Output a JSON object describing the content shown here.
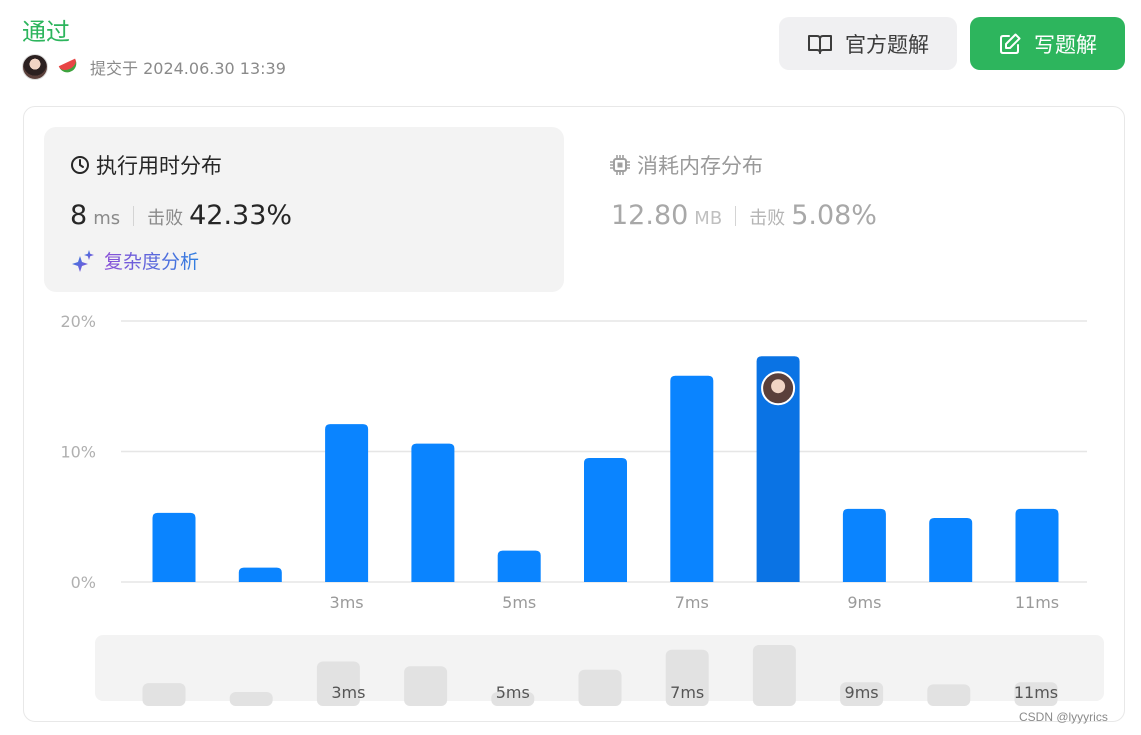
{
  "header": {
    "status": "通过",
    "submitted": "提交于 2024.06.30 13:39"
  },
  "buttons": {
    "official_solution": "官方题解",
    "write_solution": "写题解"
  },
  "runtime": {
    "title": "执行用时分布",
    "value": "8",
    "unit": "ms",
    "beat_label": "击败",
    "beat_value": "42.33%",
    "complexity_label": "复杂度分析"
  },
  "memory": {
    "title": "消耗内存分布",
    "value": "12.80",
    "unit": "MB",
    "beat_label": "击败",
    "beat_value": "5.08%"
  },
  "watermark": "CSDN @lyyyrics",
  "colors": {
    "accent_green": "#2db55d",
    "bar_blue": "#0a84ff",
    "bar_highlight": "#0a73e4",
    "overview_bar": "#e2e2e2"
  },
  "chart_data": {
    "type": "bar",
    "categories": [
      "1ms",
      "2ms",
      "3ms",
      "4ms",
      "5ms",
      "6ms",
      "7ms",
      "8ms",
      "9ms",
      "10ms",
      "11ms"
    ],
    "tick_labels": [
      "",
      "",
      "3ms",
      "",
      "5ms",
      "",
      "7ms",
      "",
      "9ms",
      "",
      "11ms"
    ],
    "values": [
      5.3,
      1.1,
      12.1,
      10.6,
      2.4,
      9.5,
      15.8,
      17.3,
      5.6,
      4.9,
      5.6
    ],
    "highlight_index": 7,
    "y_ticks": [
      "0%",
      "10%",
      "20%"
    ],
    "ylim": [
      0,
      20
    ],
    "grid": true
  }
}
